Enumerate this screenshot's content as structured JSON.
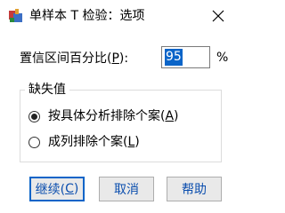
{
  "window": {
    "title": "单样本 T 检验：选项",
    "icon": "spss-dialog-icon",
    "close_icon": "close-icon"
  },
  "confidence": {
    "label_pre": "置信区间百分比(",
    "label_key": "P",
    "label_post": "):",
    "value": "95",
    "unit": "%"
  },
  "missing_values": {
    "legend": "缺失值",
    "options": [
      {
        "label_pre": "按具体分析排除个案(",
        "key": "A",
        "label_post": ")",
        "selected": true
      },
      {
        "label_pre": "成列排除个案(",
        "key": "L",
        "label_post": ")",
        "selected": false
      }
    ]
  },
  "buttons": {
    "continue": {
      "pre": "继续(",
      "key": "C",
      "post": ")"
    },
    "cancel": "取消",
    "help": "帮助"
  },
  "colors": {
    "accent": "#0a64c8",
    "button_text": "#0b4eae"
  }
}
